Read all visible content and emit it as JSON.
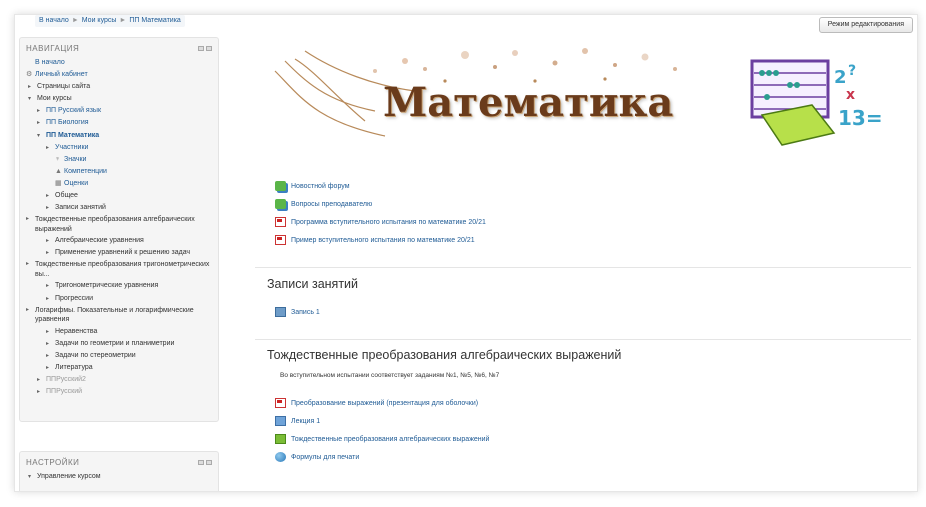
{
  "breadcrumb": {
    "items": [
      "В начало",
      "Мои курсы",
      "ПП Математика"
    ]
  },
  "header": {
    "edit_button": "Режим редактирования"
  },
  "navigation": {
    "title": "НАВИГАЦИЯ",
    "items": [
      {
        "label": "В начало",
        "level": 0,
        "twisty": "",
        "icon": "",
        "link": true,
        "bold": false
      },
      {
        "label": "Личный кабинет",
        "level": 0,
        "twisty": "",
        "icon": "dashboard",
        "link": true,
        "bold": false
      },
      {
        "label": "Страницы сайта",
        "level": 1,
        "twisty": "▸",
        "icon": "",
        "link": false,
        "bold": false
      },
      {
        "label": "Мои курсы",
        "level": 1,
        "twisty": "▾",
        "icon": "",
        "link": false,
        "bold": false
      },
      {
        "label": "ПП Русский язык",
        "level": 2,
        "twisty": "▸",
        "icon": "",
        "link": true,
        "bold": false
      },
      {
        "label": "ПП Биология",
        "level": 2,
        "twisty": "▸",
        "icon": "",
        "link": true,
        "bold": false
      },
      {
        "label": "ПП Математика",
        "level": 2,
        "twisty": "▾",
        "icon": "",
        "link": true,
        "bold": true
      },
      {
        "label": "Участники",
        "level": 3,
        "twisty": "▸",
        "icon": "",
        "link": true,
        "bold": false
      },
      {
        "label": "Значки",
        "level": 3,
        "twisty": "",
        "icon": "trophy",
        "link": true,
        "bold": false
      },
      {
        "label": "Компетенции",
        "level": 3,
        "twisty": "",
        "icon": "competency",
        "link": true,
        "bold": false
      },
      {
        "label": "Оценки",
        "level": 3,
        "twisty": "",
        "icon": "grades",
        "link": true,
        "bold": false
      },
      {
        "label": "Общее",
        "level": 3,
        "twisty": "▸",
        "icon": "",
        "link": false,
        "bold": false
      },
      {
        "label": "Записи занятий",
        "level": 3,
        "twisty": "▸",
        "icon": "",
        "link": false,
        "bold": false
      },
      {
        "label": "Тождественные преобразования алгебраических выражений",
        "level": 3,
        "twisty": "▸",
        "icon": "",
        "link": false,
        "bold": false,
        "wrap": true
      },
      {
        "label": "Алгебраические уравнения",
        "level": 3,
        "twisty": "▸",
        "icon": "",
        "link": false,
        "bold": false
      },
      {
        "label": "Применение уравнений к решению задач",
        "level": 3,
        "twisty": "▸",
        "icon": "",
        "link": false,
        "bold": false
      },
      {
        "label": "Тождественные преобразования тригонометрических вы...",
        "level": 3,
        "twisty": "▸",
        "icon": "",
        "link": false,
        "bold": false,
        "wrap": true
      },
      {
        "label": "Тригонометрические уравнения",
        "level": 3,
        "twisty": "▸",
        "icon": "",
        "link": false,
        "bold": false
      },
      {
        "label": "Прогрессии",
        "level": 3,
        "twisty": "▸",
        "icon": "",
        "link": false,
        "bold": false
      },
      {
        "label": "Логарифмы. Показательные и логарифмические уравнения",
        "level": 3,
        "twisty": "▸",
        "icon": "",
        "link": false,
        "bold": false,
        "wrap": true
      },
      {
        "label": "Неравенства",
        "level": 3,
        "twisty": "▸",
        "icon": "",
        "link": false,
        "bold": false
      },
      {
        "label": "Задачи по геометрии и планиметрии",
        "level": 3,
        "twisty": "▸",
        "icon": "",
        "link": false,
        "bold": false
      },
      {
        "label": "Задачи по стереометрии",
        "level": 3,
        "twisty": "▸",
        "icon": "",
        "link": false,
        "bold": false
      },
      {
        "label": "Литература",
        "level": 3,
        "twisty": "▸",
        "icon": "",
        "link": false,
        "bold": false
      },
      {
        "label": "ППРусский2",
        "level": 2,
        "twisty": "▸",
        "icon": "",
        "link": false,
        "bold": false,
        "muted": true
      },
      {
        "label": "ППРусский",
        "level": 2,
        "twisty": "▸",
        "icon": "",
        "link": false,
        "bold": false,
        "muted": true
      }
    ]
  },
  "settings": {
    "title": "НАСТРОЙКИ",
    "items": [
      {
        "label": "Управление курсом",
        "twisty": "▾"
      }
    ]
  },
  "banner": {
    "title": "Математика"
  },
  "top_links": [
    {
      "icon": "forum",
      "label": "Новостной форум"
    },
    {
      "icon": "forum",
      "label": "Вопросы преподавателю"
    },
    {
      "icon": "pdf",
      "label": "Программа вступительного испытания по математике 20/21"
    },
    {
      "icon": "pdf",
      "label": "Пример вступительного испытания по математике 20/21"
    }
  ],
  "sections": [
    {
      "title": "Записи занятий",
      "description": "",
      "activities": [
        {
          "icon": "recording",
          "label": "Запись 1"
        }
      ]
    },
    {
      "title": "Тождественные преобразования алгебраических выражений",
      "description": "Во вступительном испытании соответствует заданиям №1, №5, №6, №7",
      "activities": [
        {
          "icon": "pdf",
          "label": "Преобразование выражений (презентация для оболочки)"
        },
        {
          "icon": "file",
          "label": "Лекция 1"
        },
        {
          "icon": "book",
          "label": "Тождественные преобразования алгебраических выражений"
        },
        {
          "icon": "url",
          "label": "Формулы для печати"
        }
      ]
    }
  ],
  "colors": {
    "link": "#1f5b95",
    "block_bg": "#f5f5f5",
    "banner_text": "#6a3b1b"
  }
}
